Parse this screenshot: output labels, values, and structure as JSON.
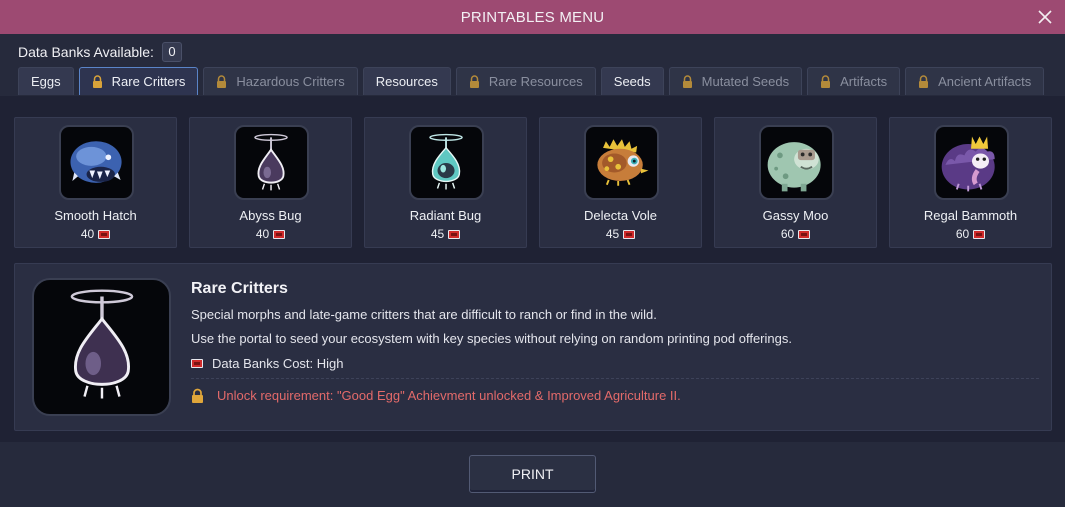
{
  "window": {
    "title": "PRINTABLES MENU",
    "close_icon": "close-icon"
  },
  "databanks": {
    "label": "Data Banks Available:",
    "count": "0"
  },
  "tabs": [
    {
      "label": "Eggs",
      "locked": false,
      "active": false
    },
    {
      "label": "Rare Critters",
      "locked": true,
      "active": true
    },
    {
      "label": "Hazardous Critters",
      "locked": true,
      "active": false
    },
    {
      "label": "Resources",
      "locked": false,
      "active": false
    },
    {
      "label": "Rare Resources",
      "locked": true,
      "active": false
    },
    {
      "label": "Seeds",
      "locked": false,
      "active": false
    },
    {
      "label": "Mutated Seeds",
      "locked": true,
      "active": false
    },
    {
      "label": "Artifacts",
      "locked": true,
      "active": false
    },
    {
      "label": "Ancient Artifacts",
      "locked": true,
      "active": false
    }
  ],
  "items": [
    {
      "name": "Smooth Hatch",
      "cost": "40",
      "icon": "smooth-hatch-icon"
    },
    {
      "name": "Abyss Bug",
      "cost": "40",
      "icon": "abyss-bug-icon"
    },
    {
      "name": "Radiant Bug",
      "cost": "45",
      "icon": "radiant-bug-icon"
    },
    {
      "name": "Delecta Vole",
      "cost": "45",
      "icon": "delecta-vole-icon"
    },
    {
      "name": "Gassy Moo",
      "cost": "60",
      "icon": "gassy-moo-icon"
    },
    {
      "name": "Regal Bammoth",
      "cost": "60",
      "icon": "regal-bammoth-icon"
    }
  ],
  "detail": {
    "title": "Rare Critters",
    "desc1": "Special morphs and late-game critters that are difficult to ranch or find in the wild.",
    "desc2": "Use the portal to seed your ecosystem with key species without relying on random printing pod offerings.",
    "cost_label": "Data Banks Cost: High",
    "unlock": "Unlock requirement: \"Good Egg\" Achievment unlocked & Improved Agriculture II.",
    "icon": "abyss-bug-icon"
  },
  "print_button": "PRINT",
  "colors": {
    "titlebar": "#9d4a72",
    "background": "#262a3c",
    "panel": "#1f2234",
    "card": "#2a2e42",
    "active_tab_border": "#5a84c8",
    "warning_text": "#e36a6a",
    "databank_chip": "#d02b2b"
  }
}
